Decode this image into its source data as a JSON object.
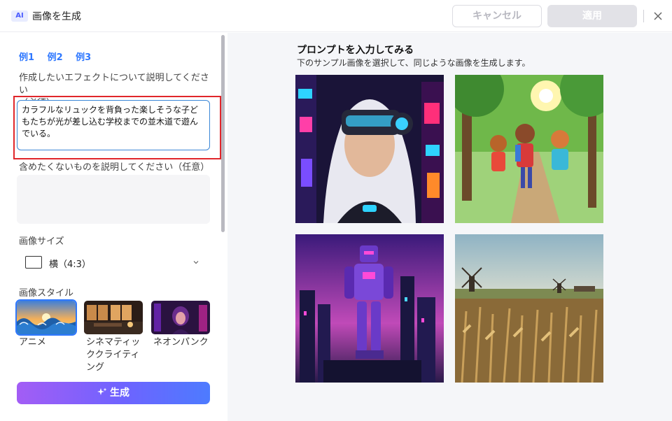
{
  "titlebar": {
    "badge": "AI",
    "title": "画像を生成",
    "cancel_label": "キャンセル",
    "apply_label": "適用"
  },
  "examples": [
    "例1",
    "例2",
    "例3"
  ],
  "prompt": {
    "label_line1": "作成したいエフェクトについて説明してください",
    "label_line2": "（必須）",
    "value": "カラフルなリュックを背負った楽しそうな子どもたちが光が差し込む学校までの並木道で遊んでいる。"
  },
  "negative": {
    "label": "含めたくないものを説明してください（任意）",
    "value": ""
  },
  "image_size": {
    "label": "画像サイズ",
    "selected": "横（4:3）"
  },
  "image_style": {
    "label": "画像スタイル",
    "options": [
      {
        "label": "アニメ",
        "selected": true
      },
      {
        "label": "シネマティッククライティング",
        "selected": false
      },
      {
        "label": "ネオンパンク",
        "selected": false
      }
    ]
  },
  "generate_label": "生成",
  "samples": {
    "title": "プロンプトを入力してみる",
    "subtitle": "下のサンプル画像を選択して、同じような画像を生成します。"
  },
  "colors": {
    "accent": "#2f78ff",
    "highlight": "#e0262b",
    "gradient_start": "#a35df5",
    "gradient_end": "#4d7bff"
  },
  "icons": [
    "close-icon",
    "chevron-down-icon",
    "sparkle-icon"
  ]
}
